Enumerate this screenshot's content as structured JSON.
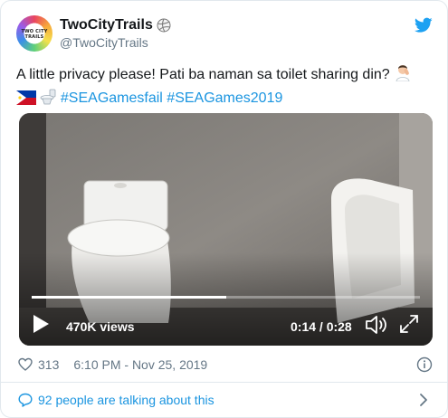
{
  "author": {
    "display_name": "TwoCityTrails",
    "handle": "@TwoCityTrails",
    "avatar_text": "TWO CITY TRAILS"
  },
  "tweet": {
    "text_line1": "A little privacy please! Pati ba naman sa toilet sharing din?",
    "hashtag1": "#SEAGamesfail",
    "hashtag2": "#SEAGames2019"
  },
  "video": {
    "views": "470K views",
    "timecode": "0:14 / 0:28",
    "progress_fraction": 0.5
  },
  "footer": {
    "likes": "313",
    "timestamp": "6:10 PM - Nov 25, 2019",
    "talking_label": "92 people are talking about this"
  },
  "colors": {
    "link": "#1b95e0",
    "muted": "#657786",
    "text": "#14171a",
    "twitter_blue": "#1da1f2"
  },
  "icons": [
    "volleyball-icon",
    "twitter-bird-icon",
    "man-facepalming-emoji",
    "philippines-flag-emoji",
    "toilet-emoji",
    "play-icon",
    "volume-icon",
    "fullscreen-icon",
    "heart-icon",
    "info-icon",
    "speech-bubble-icon",
    "chevron-right-icon"
  ]
}
